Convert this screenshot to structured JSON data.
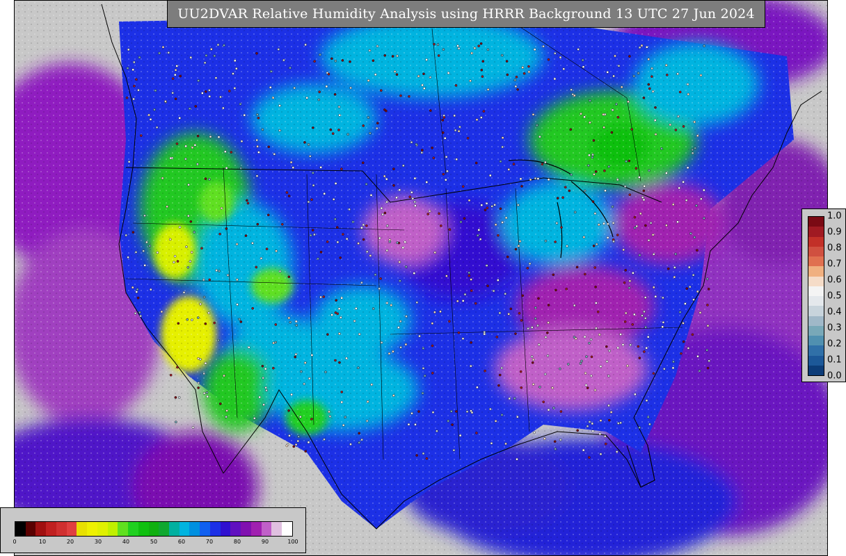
{
  "title": "UU2DVAR Relative Humidity Analysis using HRRR Background 13 UTC 27 Jun 2024",
  "colors": {
    "frame_background": "#c8c8c8",
    "title_background": "#7d7d7d",
    "title_text": "#ffffff",
    "ocean_gulf": "#2020d8",
    "ocean_atlantic": "#7a10b0",
    "ocean_pacific": "#8f1fc0",
    "dry_yellow": "#e6f000",
    "green": "#20c820",
    "cyan": "#00b4e0",
    "blue": "#1c30e6",
    "magenta": "#a020b0",
    "coastline": "#000000"
  },
  "rh_colorbar": {
    "ticks": [
      "0",
      "10",
      "20",
      "30",
      "40",
      "50",
      "60",
      "70",
      "80",
      "90",
      "100"
    ],
    "colors": [
      "#000000",
      "#5a0000",
      "#a01010",
      "#c02020",
      "#d03030",
      "#e04040",
      "#e8e000",
      "#eef000",
      "#e0f000",
      "#c0f000",
      "#60e020",
      "#20d020",
      "#10c010",
      "#10b010",
      "#10a830",
      "#00b0a0",
      "#00b4e0",
      "#0090e0",
      "#1060f0",
      "#1c30e6",
      "#3010d0",
      "#6010c0",
      "#8010b0",
      "#a020b0",
      "#c060c8",
      "#e0c0e0",
      "#ffffff"
    ]
  },
  "obs_colorbar": {
    "ticks": [
      "1.0",
      "0.9",
      "0.8",
      "0.7",
      "0.6",
      "0.5",
      "0.4",
      "0.3",
      "0.2",
      "0.1",
      "0.0"
    ],
    "colors": [
      "#7a0a14",
      "#a01a22",
      "#c23028",
      "#d05040",
      "#e07050",
      "#f0b080",
      "#f5dcc8",
      "#f4f4f4",
      "#e4e8ec",
      "#c8d4dc",
      "#a0b8c8",
      "#78a8b8",
      "#5090b0",
      "#3070a8",
      "#1c5898",
      "#0c3c78"
    ]
  }
}
